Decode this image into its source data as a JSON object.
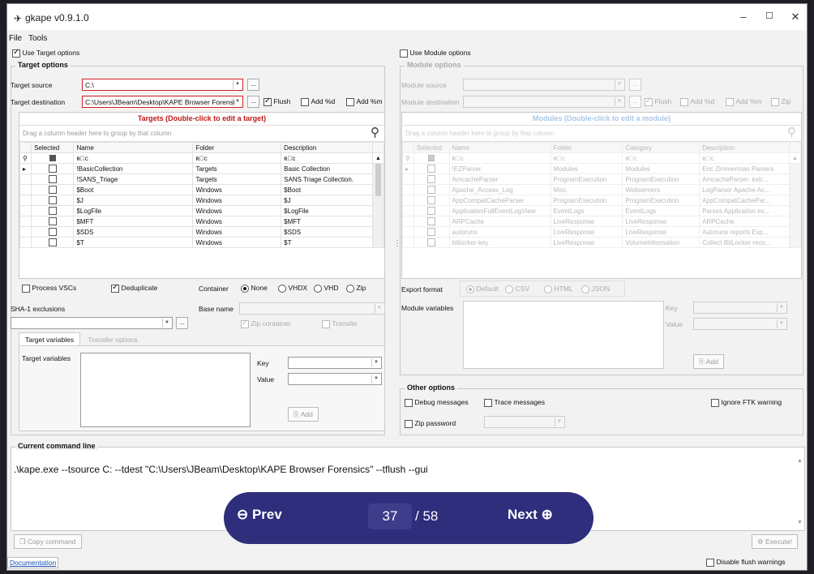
{
  "window": {
    "title": "gkape v0.9.1.0",
    "min": "–",
    "max": "☐",
    "close": "✕"
  },
  "menu": {
    "file": "File",
    "tools": "Tools"
  },
  "target": {
    "use_label": "Use Target options",
    "group_title": "Target options",
    "source_label": "Target source",
    "source_value": "C:\\",
    "dest_label": "Target destination",
    "dest_value": "C:\\Users\\JBeam\\Desktop\\KAPE Browser Forensi",
    "flush": "Flush",
    "add_d": "Add %d",
    "add_m": "Add %m",
    "grid_title": "Targets (Double-click to edit a target)",
    "drag_hint": "Drag a column header here to group by that column",
    "columns": [
      "Selected",
      "Name",
      "Folder",
      "Description"
    ],
    "filter_glyph": "ʀ⃞c",
    "rows": [
      {
        "name": "!BasicCollection",
        "folder": "Targets",
        "desc": "Basic Collection"
      },
      {
        "name": "!SANS_Triage",
        "folder": "Targets",
        "desc": "SANS Triage Collection."
      },
      {
        "name": "$Boot",
        "folder": "Windows",
        "desc": "$Boot"
      },
      {
        "name": "$J",
        "folder": "Windows",
        "desc": "$J"
      },
      {
        "name": "$LogFile",
        "folder": "Windows",
        "desc": "$LogFile"
      },
      {
        "name": "$MFT",
        "folder": "Windows",
        "desc": "$MFT"
      },
      {
        "name": "$SDS",
        "folder": "Windows",
        "desc": "$SDS"
      },
      {
        "name": "$T",
        "folder": "Windows",
        "desc": "$T"
      }
    ],
    "process_vscs": "Process VSCs",
    "dedup": "Deduplicate",
    "container": "Container",
    "c_none": "None",
    "c_vhdx": "VHDX",
    "c_vhd": "VHD",
    "c_zip": "Zip",
    "sha": "SHA-1 exclusions",
    "base_name": "Base name",
    "zip_container": "Zip container",
    "transfer": "Transfer",
    "tab_vars": "Target variables",
    "tab_transfer": "Transfer options",
    "vars_label": "Target variables",
    "key": "Key",
    "value": "Value",
    "add": "Add"
  },
  "module": {
    "use_label": "Use Module options",
    "group_title": "Module options",
    "source_label": "Module source",
    "dest_label": "Module destination",
    "flush": "Flush",
    "add_d": "Add %d",
    "add_m": "Add %m",
    "zip": "Zip",
    "grid_title": "Modules (Double-click to edit a module)",
    "drag_hint": "Drag a column header here to group by that column",
    "columns": [
      "Selected",
      "Name",
      "Folder",
      "Category",
      "Description"
    ],
    "rows": [
      {
        "name": "!EZParser",
        "folder": "Modules",
        "cat": "Modules",
        "desc": "Eric Zimmerman Parsers"
      },
      {
        "name": "AmcacheParser",
        "folder": "ProgramExecution",
        "cat": "ProgramExecution",
        "desc": "AmcacheParser: extr..."
      },
      {
        "name": "Apache_Access_Log",
        "folder": "Misc",
        "cat": "Webservers",
        "desc": "LogParser Apache Ac..."
      },
      {
        "name": "AppCompatCacheParser",
        "folder": "ProgramExecution",
        "cat": "ProgramExecution",
        "desc": "AppCompatCachePar..."
      },
      {
        "name": "ApplicationFullEventLogView",
        "folder": "EventLogs",
        "cat": "EventLogs",
        "desc": "Parses Application ev..."
      },
      {
        "name": "ARPCache",
        "folder": "LiveResponse",
        "cat": "LiveResponse",
        "desc": "ARPCache"
      },
      {
        "name": "autoruns",
        "folder": "LiveResponse",
        "cat": "LiveResponse",
        "desc": "Autoruns reports Exp..."
      },
      {
        "name": "bitlocker-key",
        "folder": "LiveResponse",
        "cat": "VolumeInformation",
        "desc": "Collect BitLocker reco..."
      }
    ],
    "export_format": "Export format",
    "ef_default": "Default",
    "ef_csv": "CSV",
    "ef_html": "HTML",
    "ef_json": "JSON",
    "vars_label": "Module variables",
    "key": "Key",
    "value": "Value",
    "add": "Add"
  },
  "other": {
    "title": "Other options",
    "debug": "Debug messages",
    "trace": "Trace messages",
    "ignore_ftk": "Ignore FTK warning",
    "zip_password": "Zip password"
  },
  "command": {
    "title": "Current command line",
    "text": ".\\kape.exe --tsource C: --tdest \"C:\\Users\\JBeam\\Desktop\\KAPE Browser Forensics\" --tflush --gui",
    "copy": "Copy command",
    "execute": "Execute!"
  },
  "status": {
    "documentation": "Documentation",
    "disable_flush": "Disable flush warnings"
  },
  "pager": {
    "prev": "Prev",
    "current": "37",
    "total": "/ 58",
    "next": "Next"
  }
}
